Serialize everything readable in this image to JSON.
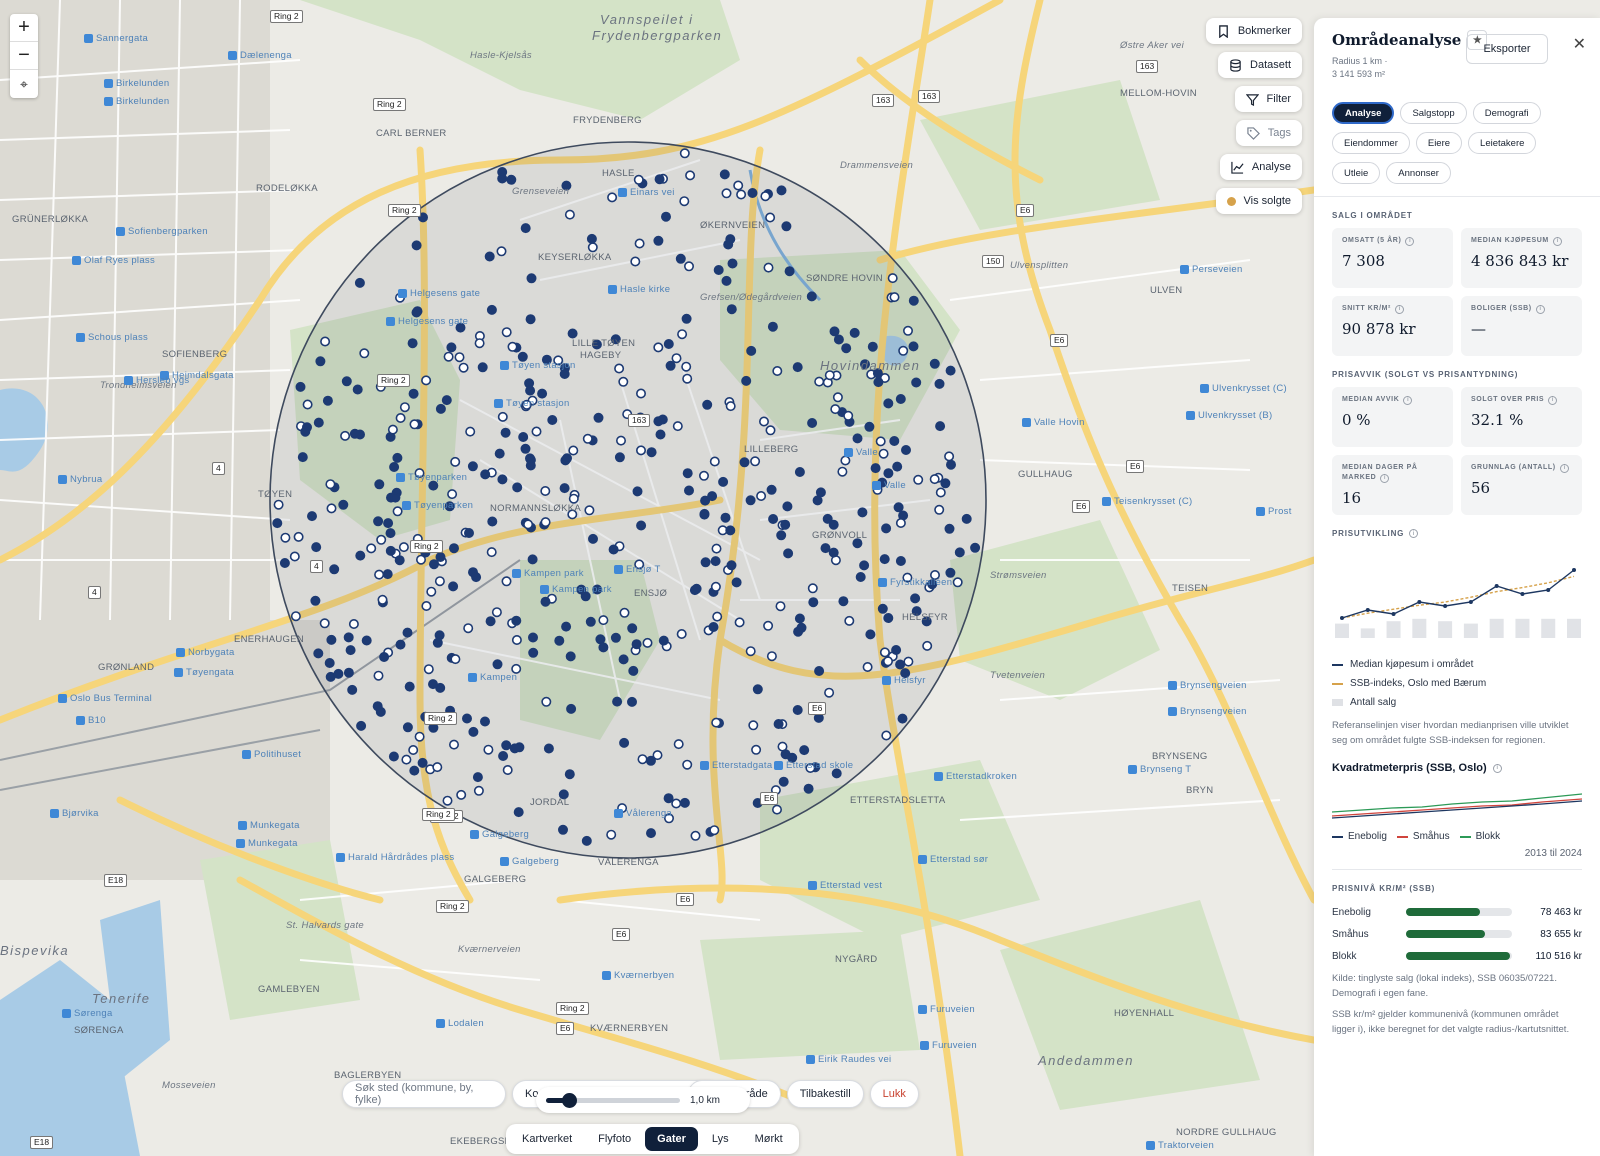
{
  "map": {
    "labels": [
      {
        "t": "Vannspeilet i",
        "c": "big"
      },
      {
        "t": "Frydenbergparken",
        "c": "big"
      },
      {
        "t": "Grenseveien",
        "c": "italic"
      },
      {
        "t": "KEYSERLØKKA",
        "c": ""
      },
      {
        "t": "Grefsen/Ødegårdveien",
        "c": "italic"
      },
      {
        "t": "ØKERNVEIEN",
        "c": ""
      },
      {
        "t": "LILLE TØYEN",
        "c": ""
      },
      {
        "t": "HAGEBY",
        "c": ""
      },
      {
        "t": "Hovindammen",
        "c": "big"
      },
      {
        "t": "LILLEBERG",
        "c": ""
      },
      {
        "t": "GRØNVOLL",
        "c": ""
      },
      {
        "t": "NORMANNSLØKKA",
        "c": ""
      },
      {
        "t": "ENSJØ",
        "c": ""
      },
      {
        "t": "HELSFYR",
        "c": ""
      },
      {
        "t": "JORDAL",
        "c": ""
      },
      {
        "t": "VÅLERENGA",
        "c": ""
      },
      {
        "t": "GALGEBERG",
        "c": ""
      },
      {
        "t": "GAMLEBYEN",
        "c": ""
      },
      {
        "t": "GRØNLAND",
        "c": ""
      },
      {
        "t": "ENERHAUGEN",
        "c": ""
      },
      {
        "t": "TØYEN",
        "c": ""
      },
      {
        "t": "SOFIENBERG",
        "c": ""
      },
      {
        "t": "RODELØKKA",
        "c": ""
      },
      {
        "t": "GRÜNERLØKKA",
        "c": ""
      },
      {
        "t": "CARL BERNER",
        "c": ""
      },
      {
        "t": "HASLE",
        "c": ""
      },
      {
        "t": "FRYDENBERG",
        "c": ""
      },
      {
        "t": "MELLOM-HOVIN",
        "c": ""
      },
      {
        "t": "SØNDRE HOVIN",
        "c": ""
      },
      {
        "t": "ULVEN",
        "c": ""
      },
      {
        "t": "GULLHAUG",
        "c": ""
      },
      {
        "t": "TEISEN",
        "c": ""
      },
      {
        "t": "BRYNSENG",
        "c": ""
      },
      {
        "t": "BRYN",
        "c": ""
      },
      {
        "t": "ETTERSTADSLETTA",
        "c": ""
      },
      {
        "t": "NYGÅRD",
        "c": ""
      },
      {
        "t": "HØYENHALL",
        "c": ""
      },
      {
        "t": "KVÆRNERBYEN",
        "c": ""
      },
      {
        "t": "SØRENGA",
        "c": ""
      },
      {
        "t": "BAGLERBYEN",
        "c": ""
      },
      {
        "t": "EKEBERGSKRENT",
        "c": ""
      },
      {
        "t": "Andedammen",
        "c": "big"
      },
      {
        "t": "Bispevika",
        "c": "big"
      },
      {
        "t": "Tenerife",
        "c": "big"
      },
      {
        "t": "NORDRE GULLHAUG",
        "c": ""
      },
      {
        "t": "Trondheimsveien",
        "c": "italic"
      },
      {
        "t": "St. Halvards gate",
        "c": "italic"
      },
      {
        "t": "Kværnerveien",
        "c": "italic"
      },
      {
        "t": "Mosseveien",
        "c": "italic"
      },
      {
        "t": "Tvetenveien",
        "c": "italic"
      },
      {
        "t": "Strømsveien",
        "c": "italic"
      },
      {
        "t": "Ulvensplitten",
        "c": "italic"
      },
      {
        "t": "Østre Aker vei",
        "c": "italic"
      },
      {
        "t": "Hasle-Kjelsås",
        "c": "italic"
      },
      {
        "t": "Drammensveien",
        "c": "italic"
      }
    ],
    "pois": [
      "Sannergata",
      "Dælenenga",
      "Birkelunden",
      "Birkelunden",
      "Sofienbergparken",
      "Olaf Ryes plass",
      "Schous plass",
      "Heimdalsgata",
      "Hersleb vgs",
      "Nybrua",
      "Tøyenparken",
      "Tøyenparken",
      "Tøyen stasjon",
      "Helgesens gate",
      "Helgesens gate",
      "Einars vei",
      "Hasle kirke",
      "Tøyen stasjon",
      "Kampen park",
      "Kampen park",
      "Ensjø T",
      "Kampen",
      "Vålerenga",
      "Galgeberg",
      "Galgeberg",
      "Etterstadgata",
      "Etterstad skole",
      "Etterstad sør",
      "Etterstad vest",
      "Norbygata",
      "Tøyengata",
      "Oslo Bus Terminal",
      "B10",
      "Politihuset",
      "Bjørvika",
      "Munkegata",
      "Munkegata",
      "Harald Hårdrådes plass",
      "Kværnerbyen",
      "Lodalen",
      "Sørenga",
      "Eirik Raudes vei",
      "Furuveien",
      "Furuveien",
      "Valle",
      "Valle",
      "Fyrstikkalléen",
      "Helsfyr",
      "Valle Hovin",
      "Teisenkrysset (C)",
      "Ulvenkrysset (C)",
      "Ulvenkrysset (B)",
      "Perseveien",
      "Brynsengveien",
      "Brynsengveien",
      "Brynseng T",
      "Etterstadkroken",
      "Traktorveien",
      "Prost"
    ],
    "signs": [
      "Ring 2",
      "Ring 2",
      "Ring 2",
      "Ring 2",
      "Ring 2",
      "Ring 2",
      "Ring 2",
      "Ring 2",
      "Ring 2",
      "Ring 2",
      "163",
      "163",
      "163",
      "163",
      "E6",
      "E6",
      "E6",
      "E6",
      "E6",
      "E6",
      "E6",
      "E6",
      "E6",
      "E18",
      "E18",
      "150",
      "4",
      "4",
      "4"
    ]
  },
  "controls": {
    "zoom_in": "+",
    "zoom_out": "−",
    "locate": "⌖",
    "bookmarks": "Bokmerker",
    "dataset": "Datasett",
    "filter": "Filter",
    "tags": "Tags",
    "analyse": "Analyse",
    "vis_solgte": "Vis solgte"
  },
  "bottom": {
    "search_placeholder": "Søk sted (kommune, by, fylke)",
    "partial_ko": "Ko",
    "draw_area": "egn område",
    "back": "Tilbakestill",
    "close": "Lukk",
    "radius_value": "1,0 km",
    "radius_fraction": 0.17,
    "layers": [
      {
        "label": "Kartverket",
        "active": false
      },
      {
        "label": "Flyfoto",
        "active": false
      },
      {
        "label": "Gater",
        "active": true
      },
      {
        "label": "Lys",
        "active": false
      },
      {
        "label": "Mørkt",
        "active": false
      }
    ]
  },
  "panel": {
    "title": "Områdeanalyse",
    "star": "★",
    "subtitle_radius": "Radius 1 km ·",
    "subtitle_area": "3 141 593 m²",
    "export": "Eksporter",
    "close": "✕",
    "tabs": [
      "Analyse",
      "Salgstopp",
      "Demografi",
      "Eiendommer",
      "Eiere",
      "Leietakere",
      "Utleie",
      "Annonser"
    ],
    "active_tab": "Analyse",
    "salg": {
      "title": "SALG I OMRÅDET",
      "cards": [
        {
          "label": "OMSATT (5 ÅR)",
          "value": "7 308"
        },
        {
          "label": "MEDIAN KJØPESUM",
          "value": "4 836 843 kr"
        },
        {
          "label": "SNITT KR/M²",
          "value": "90 878 kr"
        },
        {
          "label": "BOLIGER (SSB)",
          "value": "—"
        }
      ]
    },
    "prisavvik": {
      "title": "PRISAVVIK (SOLGT VS PRISANTYDNING)",
      "cards": [
        {
          "label": "MEDIAN AVVIK",
          "value": "0 %"
        },
        {
          "label": "SOLGT OVER PRIS",
          "value": "32.1 %"
        },
        {
          "label": "MEDIAN DAGER PÅ MARKED",
          "value": "16"
        },
        {
          "label": "GRUNNLAG (ANTALL)",
          "value": "56"
        }
      ]
    },
    "prisutvikling": {
      "title": "PRISUTVIKLING",
      "legend": [
        "Median kjøpesum i området",
        "SSB-indeks, Oslo med Bærum",
        "Antall salg"
      ],
      "note": "Referanselinjen viser hvordan medianprisen ville utviklet seg om området fulgte SSB-indeksen for regionen."
    },
    "kvm": {
      "title": "Kvadratmeterpris (SSB, Oslo)",
      "legend": [
        "Enebolig",
        "Småhus",
        "Blokk"
      ],
      "range": "2013 til 2024"
    },
    "prisniva": {
      "title": "PRISNIVÅ KR/M² (SSB)",
      "rows": [
        {
          "label": "Enebolig",
          "amount": "78 463 kr",
          "value": 78463
        },
        {
          "label": "Småhus",
          "amount": "83 655 kr",
          "value": 83655
        },
        {
          "label": "Blokk",
          "amount": "110 516 kr",
          "value": 110516
        }
      ],
      "source": "Kilde: tinglyste salg (lokal indeks), SSB 06035/07221. Demografi i egen fane.",
      "note": "SSB kr/m² gjelder kommunenivå (kommunen området ligger i), ikke beregnet for det valgte radius-/kartutsnittet."
    }
  },
  "chart_data": {
    "type": "line",
    "series": [
      {
        "name": "Median kjøpesum i området",
        "values": [
          1,
          2,
          1.5,
          3,
          2.5,
          3,
          5,
          4,
          4.5,
          7
        ]
      },
      {
        "name": "SSB-indeks, Oslo med Bærum",
        "values": [
          1,
          1.6,
          2.1,
          2.6,
          3,
          3.6,
          4.3,
          4.8,
          5.4,
          6.2
        ]
      },
      {
        "name": "Antall salg",
        "values": [
          6,
          4,
          7,
          8,
          7,
          6,
          8,
          8,
          8,
          8
        ]
      }
    ]
  },
  "colors": {
    "accent": "#10203a",
    "dot": "#1d3a73",
    "gold": "#d6a24b",
    "green": "#1f6b3a",
    "circle": "rgba(60,70,90,0.10)"
  }
}
